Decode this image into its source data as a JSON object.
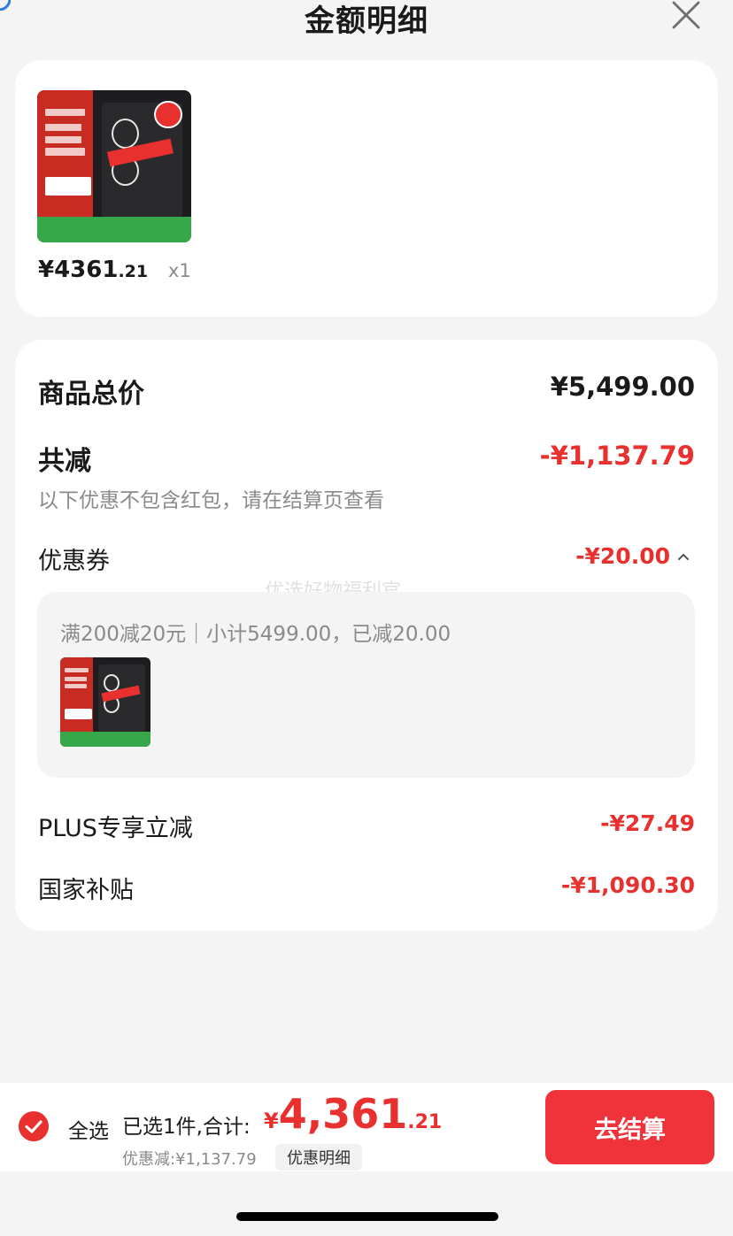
{
  "header": {
    "title": "金额明细"
  },
  "product": {
    "price_main": "¥4361",
    "price_cents": ".21",
    "quantity": "x1"
  },
  "summary": {
    "total_label": "商品总价",
    "total_value": "¥5,499.00",
    "reduce_label": "共减",
    "reduce_value": "-¥1,137.79",
    "reduce_note": "以下优惠不包含红包，请在结算页查看",
    "coupon_label": "优惠券",
    "coupon_value": "-¥20.00",
    "coupon_detail": "满200减20元｜小计5499.00，已减20.00",
    "watermark": "优选好物福利官",
    "plus_label": "PLUS专享立减",
    "plus_value": "-¥27.49",
    "gov_label": "国家补贴",
    "gov_value": "-¥1,090.30"
  },
  "bottom": {
    "select_all": "全选",
    "selected_text": "已选1件,合计:",
    "grand_symbol": "¥",
    "grand_integer": "4,361",
    "grand_decimal": ".21",
    "discount_note": "优惠减:¥1,137.79",
    "detail_link": "优惠明细",
    "checkout": "去结算"
  },
  "icons": {
    "close": "close-icon",
    "caret": "chevron-up-icon",
    "check": "check-circle-icon"
  },
  "colors": {
    "accent_red": "#e8302f",
    "button_red": "#f0333b",
    "background": "#f4f4f4",
    "corner_blue": "#2a7ae2"
  }
}
